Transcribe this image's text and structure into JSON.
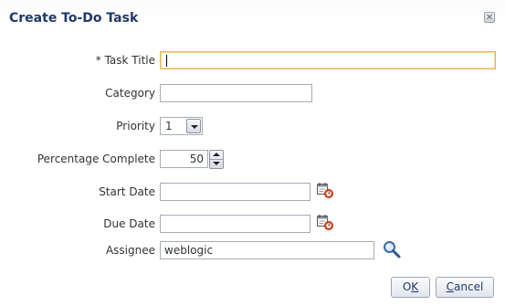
{
  "dialog": {
    "title": "Create To-Do Task",
    "close_glyph": "✕"
  },
  "fields": {
    "task_title": {
      "required_mark": "* ",
      "label": "Task Title",
      "value": ""
    },
    "category": {
      "label": "Category",
      "value": ""
    },
    "priority": {
      "label": "Priority",
      "value": "1"
    },
    "percentage_complete": {
      "label": "Percentage Complete",
      "value": "50"
    },
    "start_date": {
      "label": "Start Date",
      "value": ""
    },
    "due_date": {
      "label": "Due Date",
      "value": ""
    },
    "assignee": {
      "label": "Assignee",
      "value": "weblogic"
    }
  },
  "buttons": {
    "ok_mnemonic": "K",
    "ok_prefix": "O",
    "cancel_mnemonic": "C",
    "cancel_rest": "ancel"
  },
  "icons": {
    "start_date_picker": "calendar-icon",
    "due_date_picker": "calendar-icon",
    "assignee_search": "magnifier-icon"
  },
  "colors": {
    "title": "#1f3a68",
    "focus_border": "#e5b95a"
  }
}
